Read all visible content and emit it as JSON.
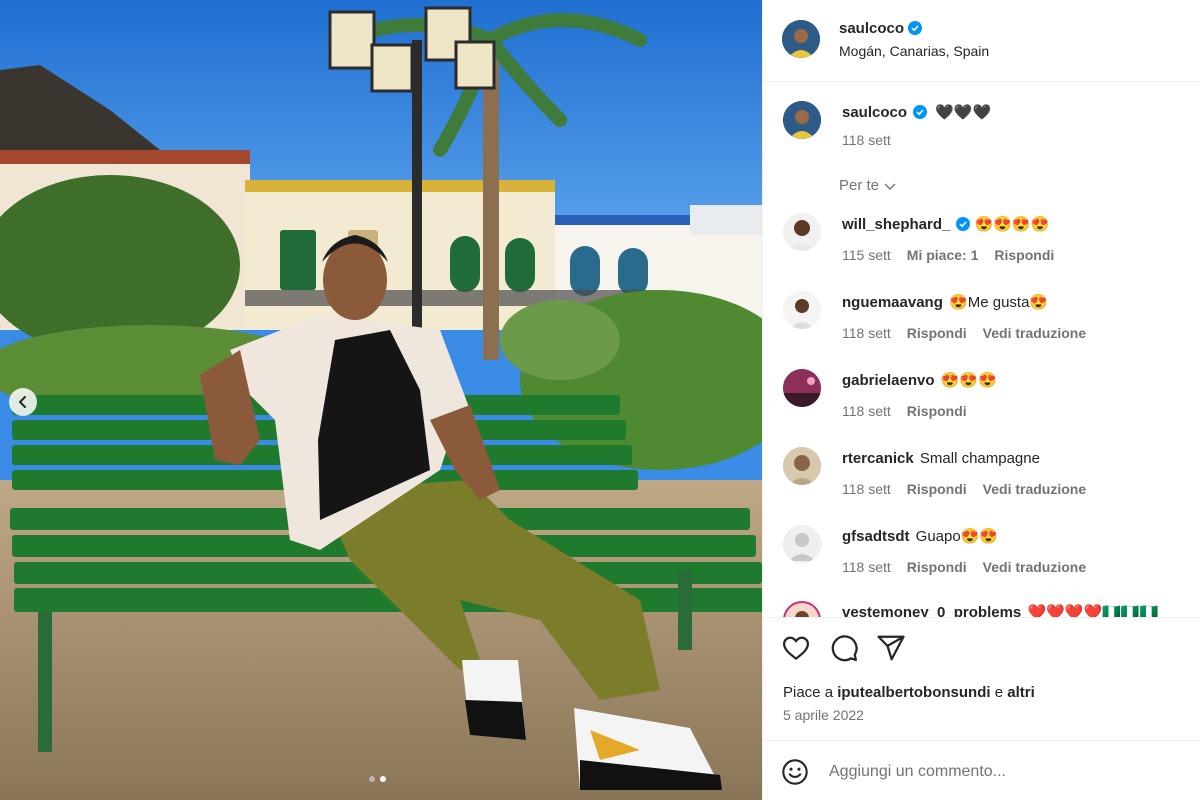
{
  "post": {
    "author": "saulcoco",
    "location": "Mogán, Canarias, Spain",
    "caption": "🖤🖤🖤",
    "caption_time": "118 sett",
    "author_avatar_color": "#2d5a86"
  },
  "filter": {
    "label": "Per te"
  },
  "comments": [
    {
      "user": "will_shephard_",
      "verified": true,
      "text": "😍😍😍😍",
      "time": "115 sett",
      "likes": "Mi piace: 1",
      "reply": "Rispondi",
      "translate": "",
      "avatar_color": "#f1f1f1"
    },
    {
      "user": "nguemaavang",
      "verified": false,
      "text": "😍Me gusta😍",
      "time": "118 sett",
      "likes": "",
      "reply": "Rispondi",
      "translate": "Vedi traduzione",
      "avatar_color": "#e8e8e8"
    },
    {
      "user": "gabrielaenvo",
      "verified": false,
      "text": "😍😍😍",
      "time": "118 sett",
      "likes": "",
      "reply": "Rispondi",
      "translate": "",
      "avatar_color": "#b03a6a"
    },
    {
      "user": "rtercanick",
      "verified": false,
      "text": "Small champagne",
      "time": "118 sett",
      "likes": "",
      "reply": "Rispondi",
      "translate": "Vedi traduzione",
      "avatar_color": "#cbb89c"
    },
    {
      "user": "gfsadtsdt",
      "verified": false,
      "text": "Guapo😍😍",
      "time": "118 sett",
      "likes": "",
      "reply": "Rispondi",
      "translate": "Vedi traduzione",
      "avatar_color": "#dbdbdb"
    },
    {
      "user": "vestemoney_0_problems",
      "verified": false,
      "text": "❤️❤️❤️❤️🇳🇬🇳🇬🇳🇬",
      "time": "",
      "likes": "",
      "reply": "",
      "translate": "",
      "avatar_color": "#c44f8f"
    }
  ],
  "engagement": {
    "liked_by_prefix": "Piace a",
    "liked_by_user": "iputealbertobonsundi",
    "liked_by_and": "e",
    "liked_by_others": "altri",
    "date": "5 aprile 2022"
  },
  "composer": {
    "placeholder": "Aggiungi un commento..."
  },
  "icons": {
    "like": "heart-icon",
    "comment": "comment-bubble-icon",
    "share": "paper-plane-icon",
    "emoji": "smiley-icon",
    "verified": "verified-badge-icon",
    "prev": "chevron-left-icon"
  },
  "carousel": {
    "slides": 2,
    "active": 2
  },
  "colors": {
    "verified": "#0095f6",
    "text": "#262626",
    "muted": "#737373",
    "bench": "#1f7a2e"
  }
}
